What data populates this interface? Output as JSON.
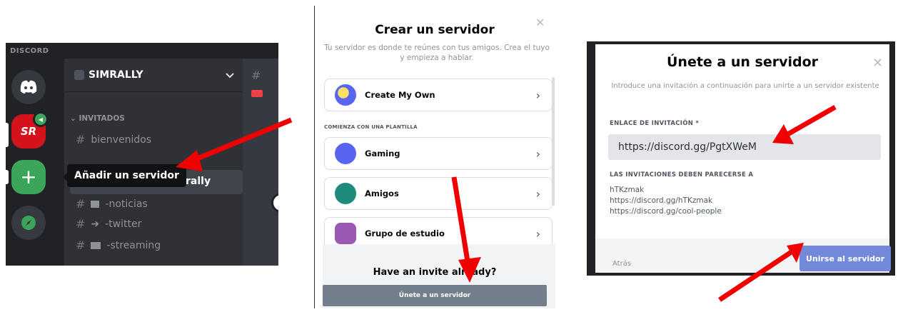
{
  "panel1": {
    "app_label": "DISCORD",
    "server_name": "SIMRALLY",
    "server_badge": "SR",
    "category": "INVITADOS",
    "channels": [
      "bienvenidos",
      "rally",
      "-noticias",
      "-twitter",
      "-streaming"
    ],
    "tooltip": "Añadir un servidor",
    "add_symbol": "+"
  },
  "panel2": {
    "title": "Crear un servidor",
    "subtitle": "Tu servidor es donde te reúnes con tus amigos. Crea el tuyo y empieza a hablar.",
    "options": [
      "Create My Own",
      "Gaming",
      "Amigos",
      "Grupo de estudio"
    ],
    "section": "COMIENZA CON UNA PLANTILLA",
    "invite_question": "Have an invite already?",
    "join_button": "Únete a un servidor"
  },
  "panel3": {
    "title": "Únete a un servidor",
    "subtitle": "Introduce una invitación a continuación para unirte a un servidor existente",
    "link_label": "ENLACE DE INVITACIÓN *",
    "link_value": "https://discord.gg/PgtXWeM",
    "examples_label": "LAS INVITACIONES DEBEN PARECERSE A",
    "examples": [
      "hTKzmak",
      "https://discord.gg/hTKzmak",
      "https://discord.gg/cool-people"
    ],
    "back": "Atrás",
    "submit": "Unirse al servidor"
  },
  "icons": [
    "discord-logo-icon",
    "plus-icon",
    "compass-icon",
    "chevron-down-icon",
    "hash-icon",
    "close-icon",
    "chevron-right-icon"
  ],
  "colors": {
    "arrow": "#f00000",
    "discord_dark": "#202225",
    "green": "#3ba55c",
    "blurple": "#7289da"
  }
}
